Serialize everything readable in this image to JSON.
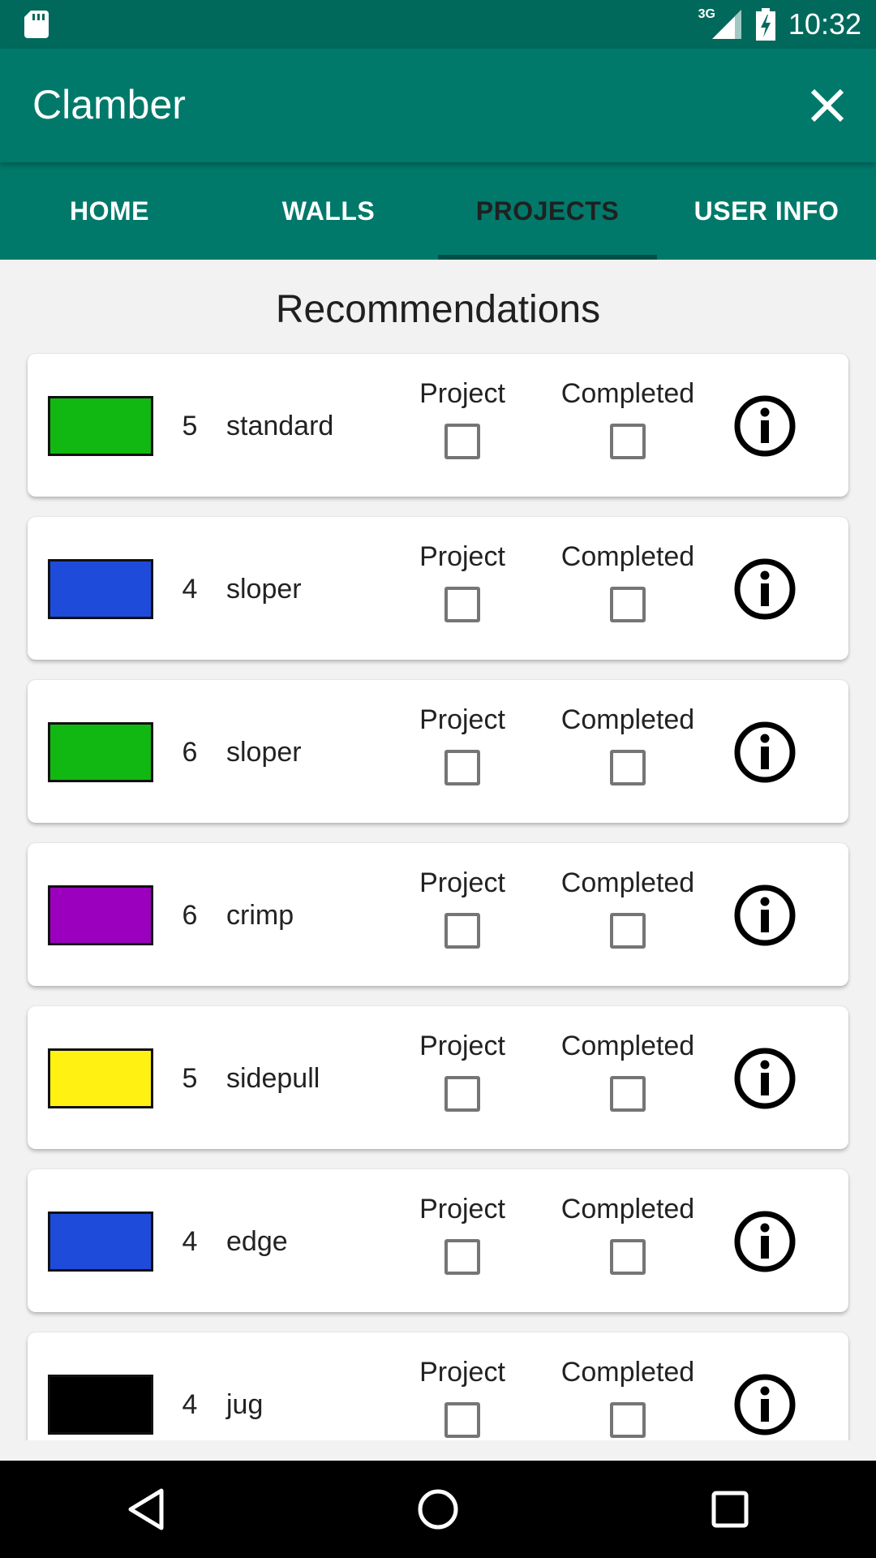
{
  "status_bar": {
    "network": "3G",
    "time": "10:32"
  },
  "app_bar": {
    "title": "Clamber"
  },
  "tabs": [
    {
      "label": "HOME",
      "active": false
    },
    {
      "label": "WALLS",
      "active": false
    },
    {
      "label": "PROJECTS",
      "active": true
    },
    {
      "label": "USER INFO",
      "active": false
    }
  ],
  "main": {
    "heading": "Recommendations",
    "items": [
      {
        "color": "#12b812",
        "grade": "5",
        "hold": "standard",
        "project_label": "Project",
        "completed_label": "Completed",
        "project_checked": false,
        "completed_checked": false
      },
      {
        "color": "#1f4bdb",
        "grade": "4",
        "hold": "sloper",
        "project_label": "Project",
        "completed_label": "Completed",
        "project_checked": false,
        "completed_checked": false
      },
      {
        "color": "#12b812",
        "grade": "6",
        "hold": "sloper",
        "project_label": "Project",
        "completed_label": "Completed",
        "project_checked": false,
        "completed_checked": false
      },
      {
        "color": "#9b00bf",
        "grade": "6",
        "hold": "crimp",
        "project_label": "Project",
        "completed_label": "Completed",
        "project_checked": false,
        "completed_checked": false
      },
      {
        "color": "#fff212",
        "grade": "5",
        "hold": "sidepull",
        "project_label": "Project",
        "completed_label": "Completed",
        "project_checked": false,
        "completed_checked": false
      },
      {
        "color": "#1f4bdb",
        "grade": "4",
        "hold": "edge",
        "project_label": "Project",
        "completed_label": "Completed",
        "project_checked": false,
        "completed_checked": false
      },
      {
        "color": "#000000",
        "grade": "4",
        "hold": "jug",
        "project_label": "Project",
        "completed_label": "Completed",
        "project_checked": false,
        "completed_checked": false
      }
    ]
  },
  "colors": {
    "status_bar": "#00695c",
    "app_bar": "#00796b",
    "background": "#f2f2f2"
  },
  "icons": {
    "close": "close-icon",
    "info": "info-icon",
    "back": "back-icon",
    "home": "home-icon",
    "recents": "recents-icon"
  }
}
